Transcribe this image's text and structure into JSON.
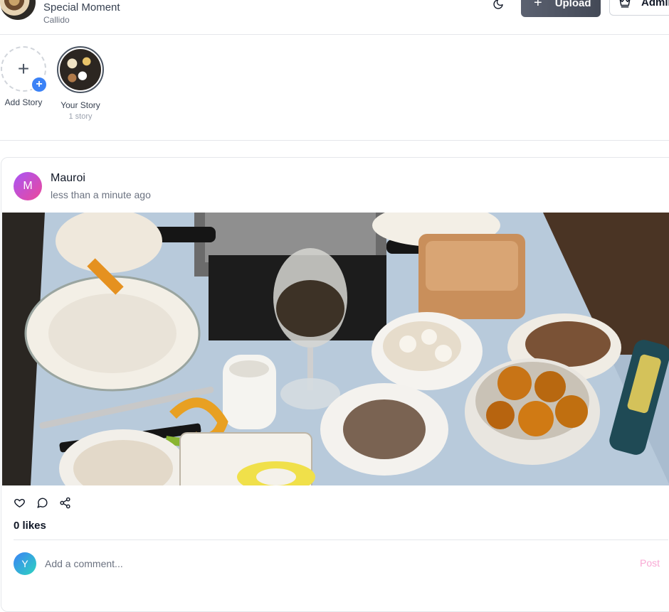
{
  "header": {
    "app_title": "Special Moment",
    "app_subtitle": "Callido",
    "upload_label": "Upload",
    "admin_label": "Admin"
  },
  "stories": {
    "add_label": "Add Story",
    "own_label": "Your Story",
    "own_count": "1 story"
  },
  "post": {
    "author_initial": "M",
    "author_name": "Mauroi",
    "time": "less than a minute ago",
    "likes": "0 likes",
    "comment_avatar_initial": "Y",
    "comment_placeholder": "Add a comment...",
    "post_label": "Post"
  },
  "colors": {
    "upload_bg": "#4b5160",
    "story_add_badge": "#3b82f6",
    "author_avatar": "#c046d6",
    "comment_avatar": "#3b82f6",
    "post_button": "#f9a8d4"
  },
  "icons": {
    "theme": "moon-icon",
    "upload": "plus-icon",
    "admin": "crown-icon",
    "like": "heart-icon",
    "comment": "message-circle-icon",
    "share": "share-icon"
  }
}
